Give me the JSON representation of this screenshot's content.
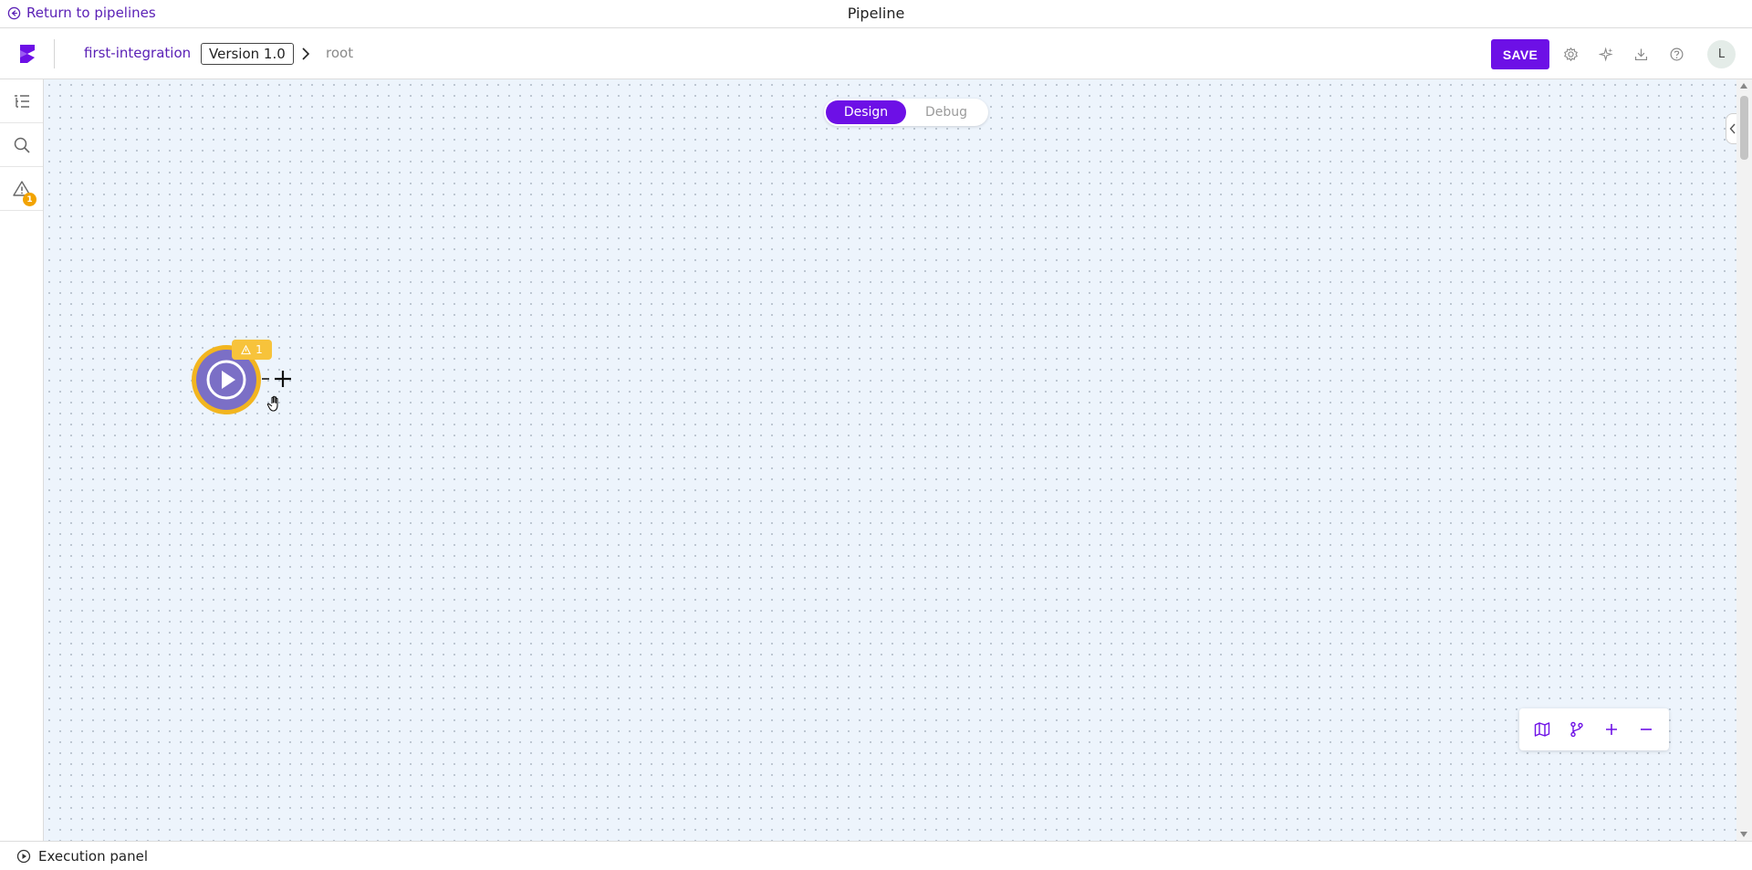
{
  "titlebar": {
    "back_label": "Return to pipelines",
    "title": "Pipeline"
  },
  "toolbar": {
    "project_name": "first-integration",
    "version": "Version 1.0",
    "breadcrumb_root": "root",
    "save_label": "SAVE",
    "icons": [
      "gear-icon",
      "sparkle-icon",
      "download-icon",
      "help-icon"
    ],
    "avatar_initial": "L"
  },
  "leftrail": {
    "items": [
      {
        "name": "outline-icon"
      },
      {
        "name": "search-icon"
      },
      {
        "name": "warning-icon",
        "badge": "1"
      }
    ]
  },
  "canvas": {
    "mode_toggle": {
      "options": [
        "Design",
        "Debug"
      ],
      "active": "Design"
    },
    "start_node": {
      "warning_count": "1"
    }
  },
  "zoom_controls": [
    "map-icon",
    "branch-icon",
    "zoom-in-icon",
    "zoom-out-icon"
  ],
  "bottombar": {
    "execution_panel_label": "Execution panel"
  },
  "colors": {
    "accent": "#6d10e6",
    "link": "#5b21b6",
    "warning": "#f2b51f",
    "node": "#7b6fc6",
    "canvas": "#edf4fc"
  }
}
